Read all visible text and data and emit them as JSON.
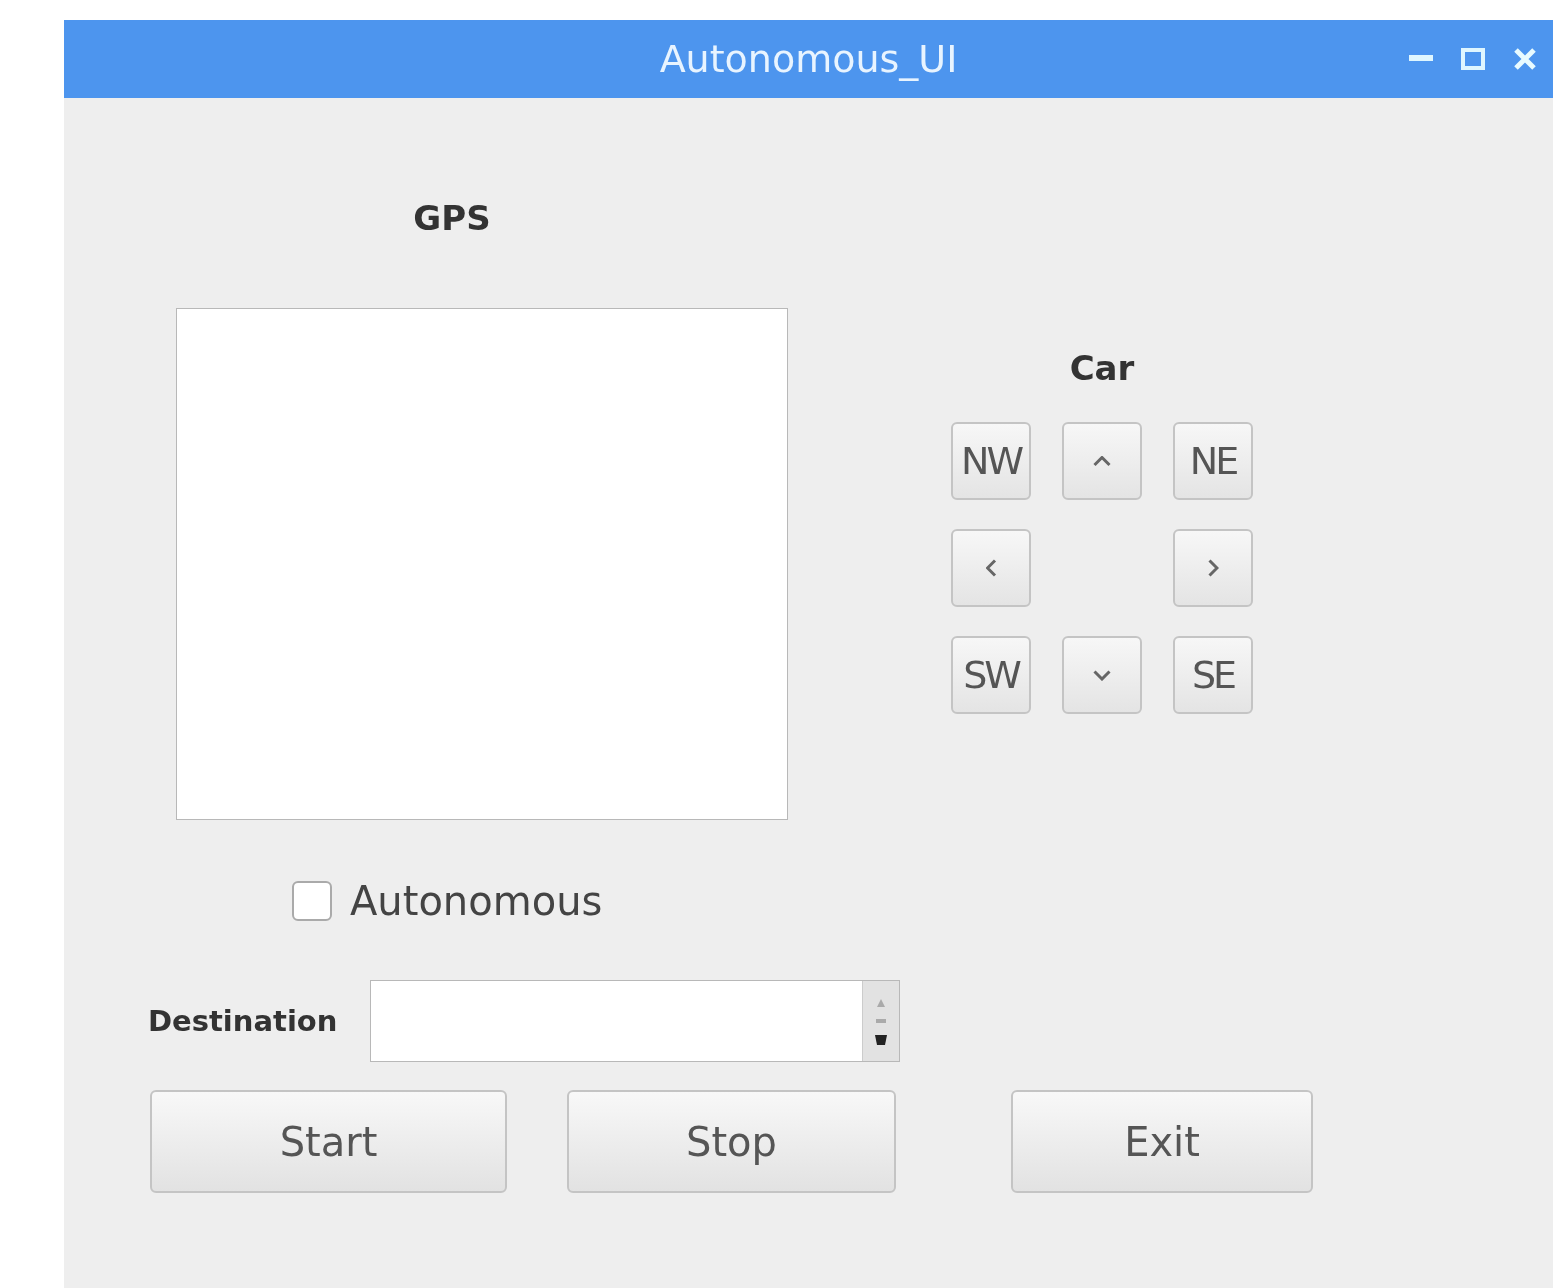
{
  "window": {
    "title": "Autonomous_UI"
  },
  "gps": {
    "label": "GPS"
  },
  "car": {
    "label": "Car",
    "rows": [
      [
        {
          "kind": "text",
          "label": "NW"
        },
        {
          "kind": "up"
        },
        {
          "kind": "text",
          "label": "NE"
        }
      ],
      [
        {
          "kind": "left"
        },
        {
          "kind": "right"
        }
      ],
      [
        {
          "kind": "text",
          "label": "SW"
        },
        {
          "kind": "down"
        },
        {
          "kind": "text",
          "label": "SE"
        }
      ]
    ]
  },
  "autonomous": {
    "label": "Autonomous",
    "checked": false
  },
  "destination": {
    "label": "Destination"
  },
  "buttons": [
    "Start",
    "Stop",
    "Exit"
  ]
}
